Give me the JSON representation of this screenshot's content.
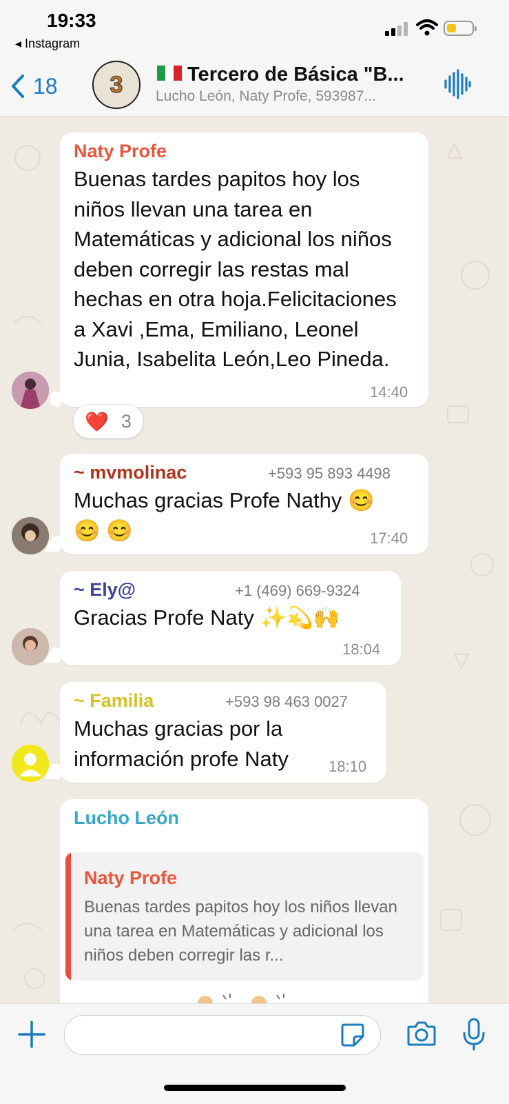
{
  "status_bar": {
    "time": "19:33",
    "back_app": "◂ Instagram"
  },
  "header": {
    "back_count": "18",
    "group_avatar_text": "3",
    "title": "Tercero de Básica \"B...",
    "subtitle": "Lucho León, Naty Profe, 593987..."
  },
  "messages": [
    {
      "sender": "Naty Profe",
      "text": "Buenas tardes papitos hoy los niños llevan una tarea en Matemáticas y adicional los niños deben corregir las restas mal hechas en otra hoja.Felicitaciones a Xavi ,Ema, Emiliano, Leonel Junia, Isabelita León,Leo Pineda.",
      "time": "14:40",
      "reaction": {
        "emoji": "❤️",
        "count": "3"
      }
    },
    {
      "sender": "~ mvmolinac",
      "phone": "+593 95 893 4498",
      "text": "Muchas gracias Profe Nathy 😊 😊 😊",
      "time": "17:40"
    },
    {
      "sender": "~ Ely@",
      "phone": "+1 (469) 669-9324",
      "text": "Gracias Profe Naty ✨💫🙌",
      "time": "18:04"
    },
    {
      "sender": "~ Familia",
      "phone": "+593 98 463 0027",
      "text": "Muchas gracias por la información profe Naty",
      "time": "18:10"
    },
    {
      "sender": "Lucho León",
      "quote": {
        "sender": "Naty Profe",
        "text": "Buenas tardes papitos hoy los niños llevan una tarea en Matemáticas y adicional los niños deben corregir las r..."
      }
    }
  ],
  "colors": {
    "accent": "#1a7bbf",
    "naty": "#e8563e",
    "mvmolinac": "#b0331d",
    "ely": "#3e4399",
    "familia": "#d4c22a",
    "lucho": "#35a8c8"
  }
}
